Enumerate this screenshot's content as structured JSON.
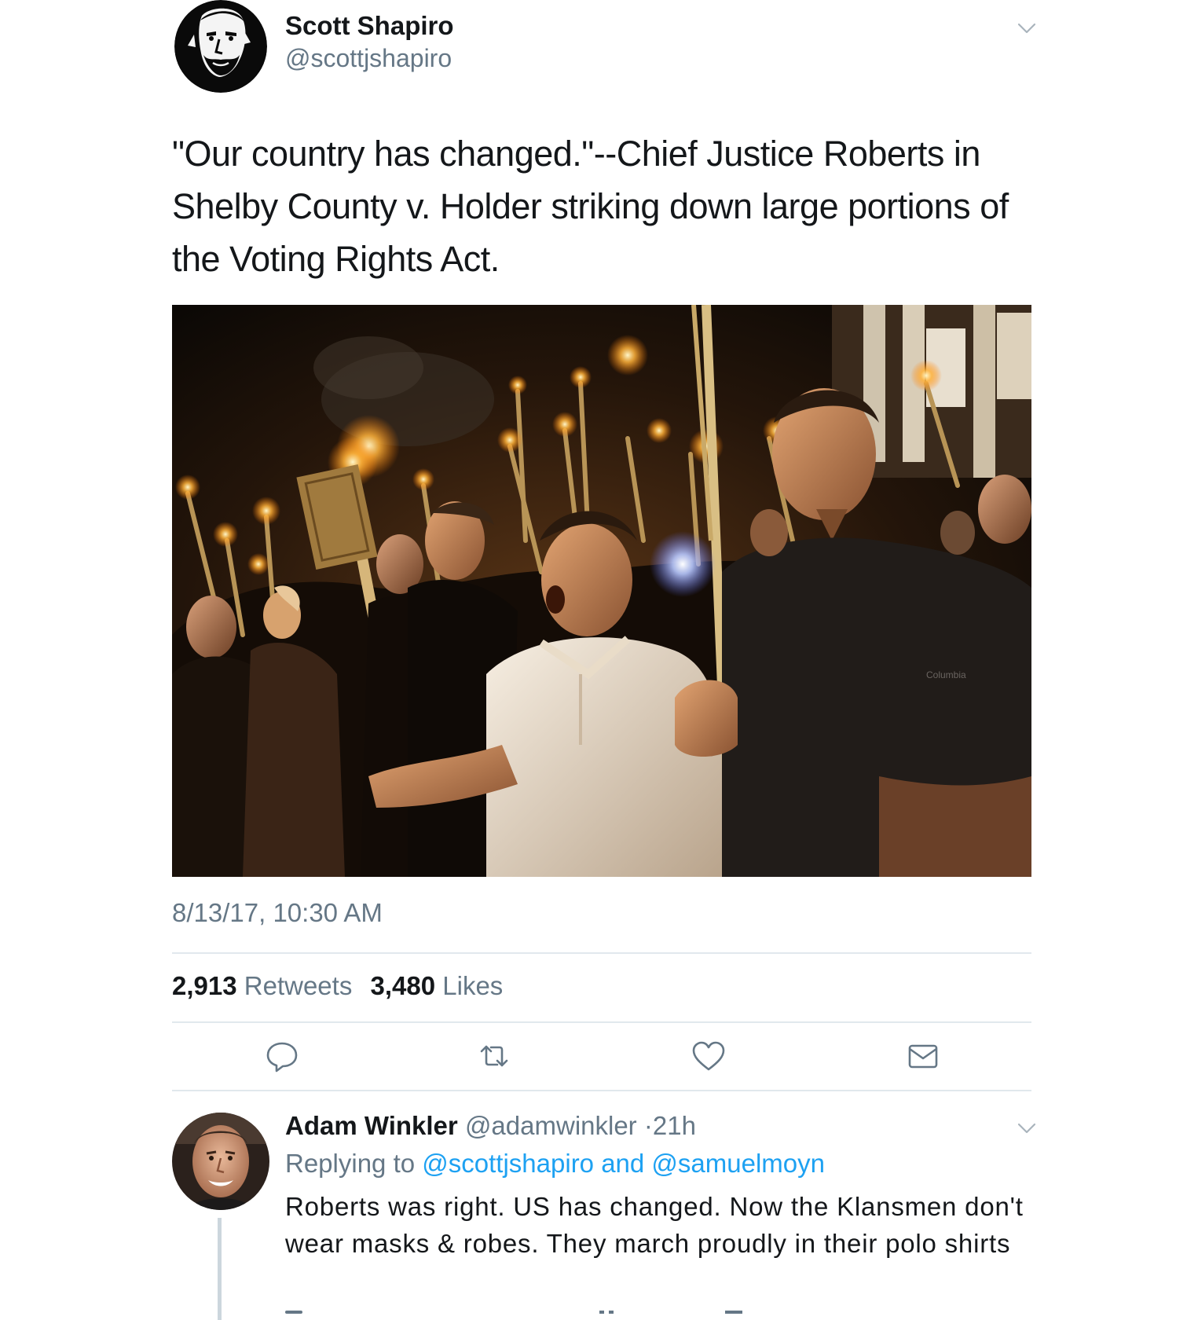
{
  "tweet": {
    "author_name": "Scott Shapiro",
    "author_handle": "@scottjshapiro",
    "text": "\"Our country has changed.\"--Chief Justice Roberts in Shelby County v. Holder striking down large portions of the Voting Rights Act.",
    "media": {
      "icon": "photo-torch-march",
      "shirt_logo_text": "Columbia"
    },
    "timestamp": "8/13/17, 10:30 AM",
    "retweets_count": "2,913",
    "retweets_label": "Retweets",
    "likes_count": "3,480",
    "likes_label": "Likes",
    "actions": [
      "reply-icon",
      "retweet-icon",
      "like-icon",
      "direct-message-icon"
    ]
  },
  "reply": {
    "author_name": "Adam Winkler",
    "author_handle": "@adamwinkler",
    "separator": "·",
    "time": "21h",
    "replying_prefix": "Replying to",
    "replying_mentions": "@scottjshapiro and @samuelmoyn",
    "text": "Roberts was right. US has changed. Now the Klansmen don't wear masks & robes. They march proudly in their polo shirts"
  },
  "colors": {
    "text_primary": "#14171a",
    "text_secondary": "#657786",
    "link": "#1da1f2",
    "divider": "#e1e8ed",
    "icon": "#657786"
  }
}
